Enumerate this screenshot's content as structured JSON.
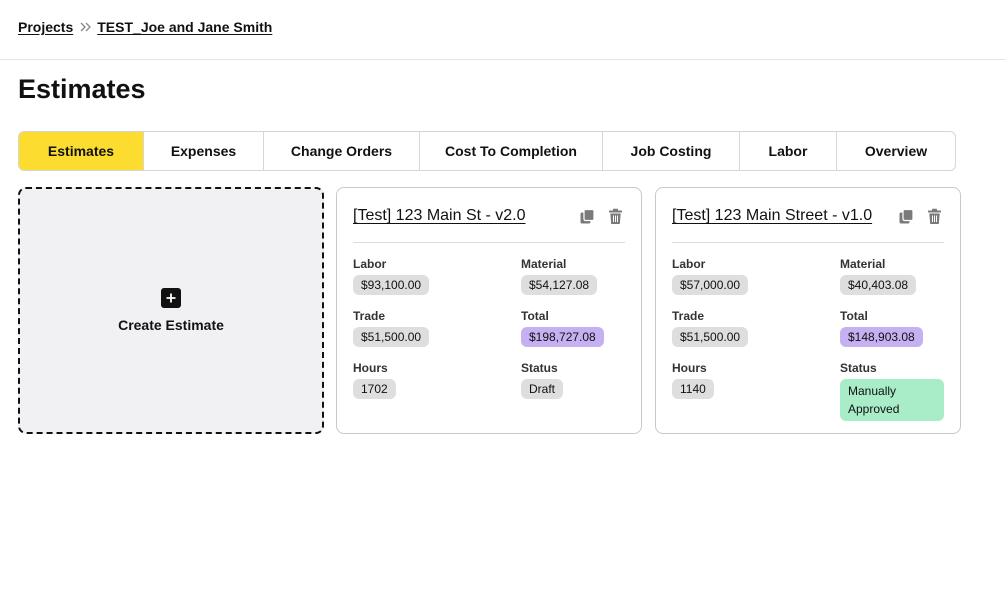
{
  "breadcrumb": {
    "projects": "Projects",
    "project": "TEST_Joe and Jane Smith"
  },
  "page": {
    "title": "Estimates"
  },
  "tabs": [
    {
      "label": "Estimates"
    },
    {
      "label": "Expenses"
    },
    {
      "label": "Change Orders"
    },
    {
      "label": "Cost To Completion"
    },
    {
      "label": "Job Costing"
    },
    {
      "label": "Labor"
    },
    {
      "label": "Overview"
    }
  ],
  "create": {
    "label": "Create Estimate"
  },
  "labels": {
    "labor": "Labor",
    "material": "Material",
    "trade": "Trade",
    "total": "Total",
    "hours": "Hours",
    "status": "Status"
  },
  "estimates": [
    {
      "title": "[Test] 123 Main St - v2.0",
      "labor": "$93,100.00",
      "material": "$54,127.08",
      "trade": "$51,500.00",
      "total": "$198,727.08",
      "hours": "1702",
      "status": "Draft"
    },
    {
      "title": "[Test] 123 Main Street - v1.0",
      "labor": "$57,000.00",
      "material": "$40,403.08",
      "trade": "$51,500.00",
      "total": "$148,903.08",
      "hours": "1140",
      "status": "Manually Approved"
    }
  ],
  "colors": {
    "active_tab": "#fcdc2f",
    "total_pill": "#c5b0f2",
    "approved_pill": "#a8ecc8",
    "neutral_pill": "#dedede"
  },
  "icons": {
    "breadcrumb_separator": "double-chevron-right-icon",
    "create": "plus-icon",
    "duplicate": "copy-icon",
    "delete": "trash-icon"
  }
}
